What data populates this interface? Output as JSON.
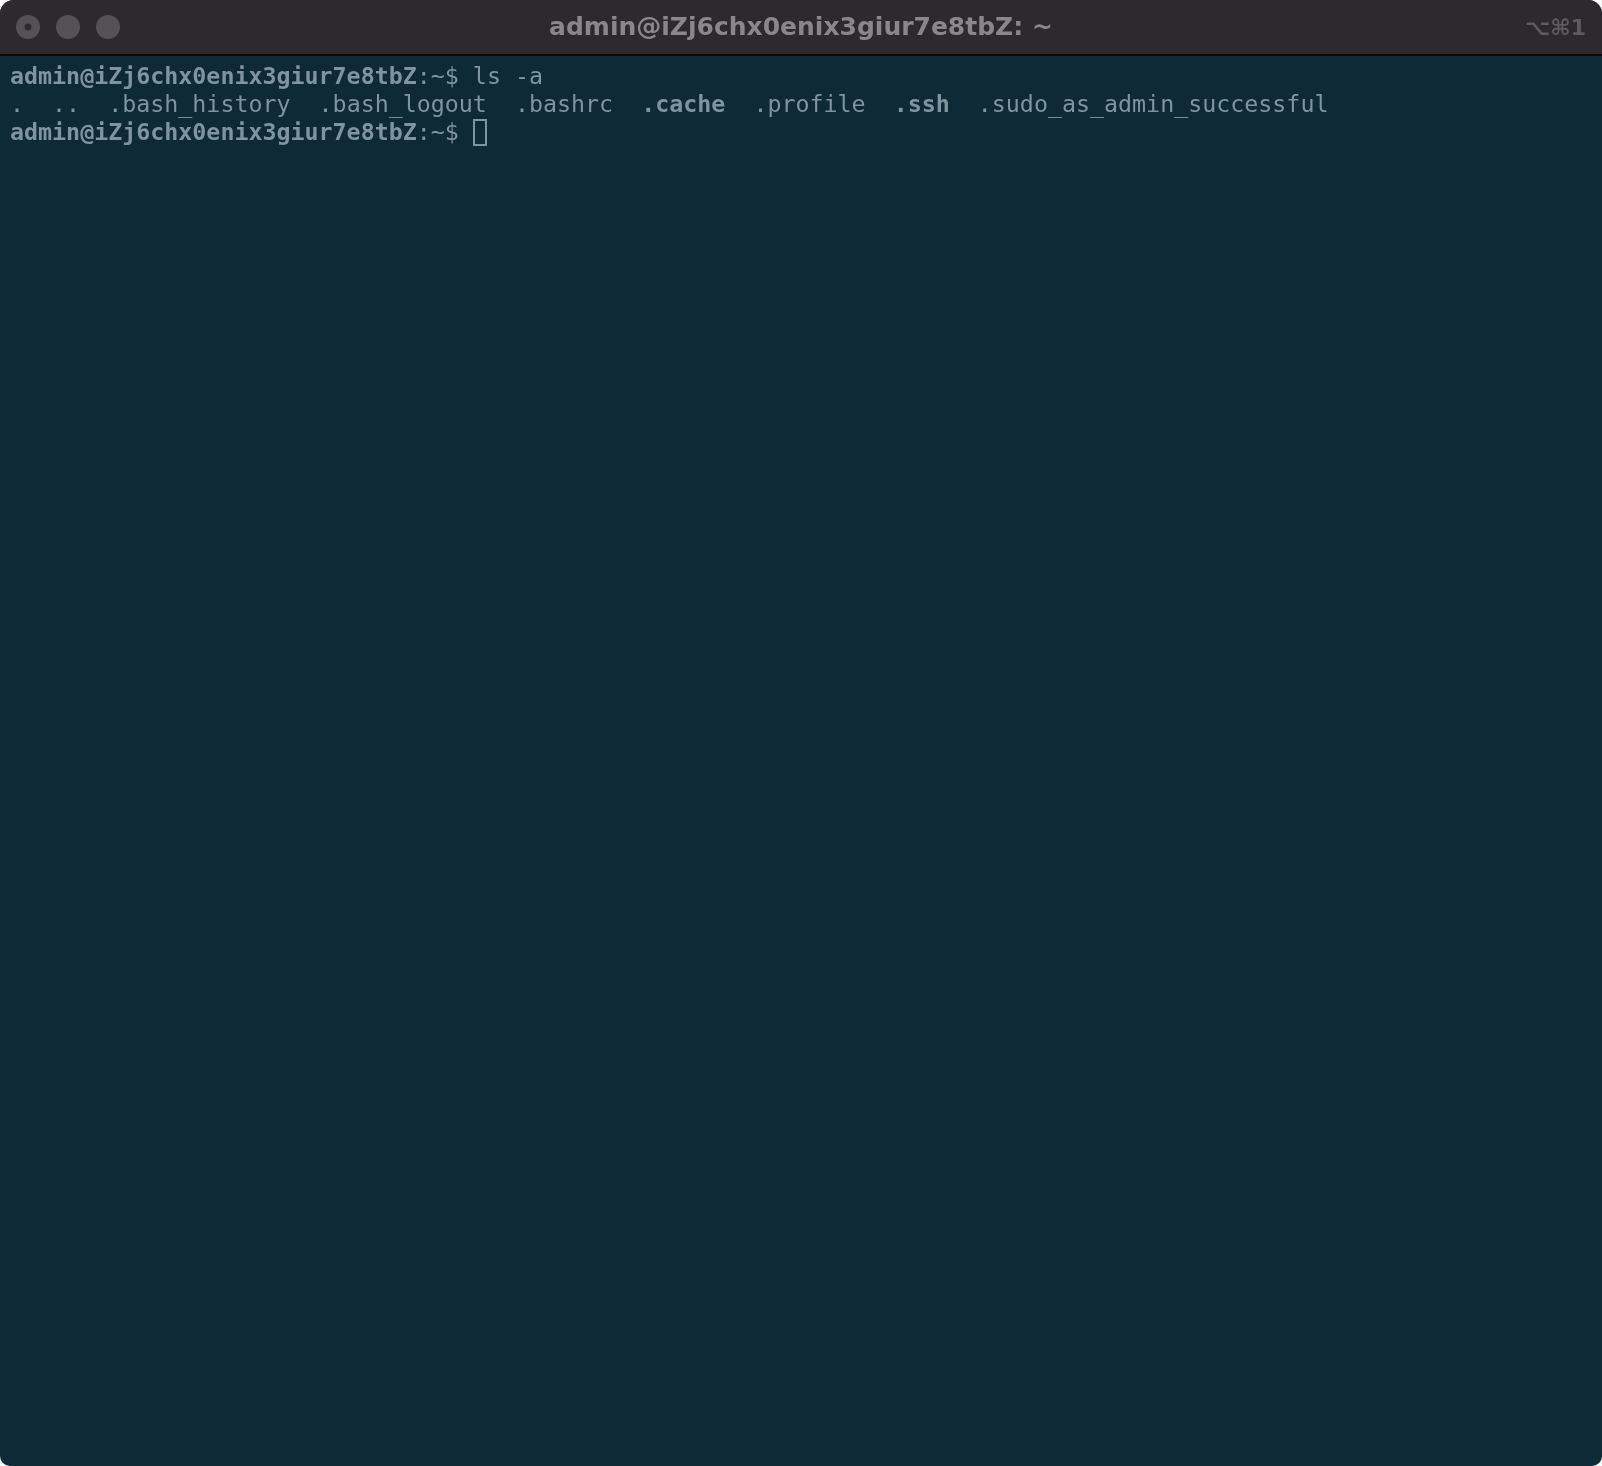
{
  "window": {
    "title": "admin@iZj6chx0enix3giur7e8tbZ: ~",
    "shortcut": "⌥⌘1"
  },
  "lines": [
    {
      "kind": "command",
      "prompt_user": "admin@iZj6chx0enix3giur7e8tbZ",
      "prompt_path": ":~$",
      "command": "ls -a",
      "cursor": false
    },
    {
      "kind": "listing",
      "entries": [
        {
          "name": ".",
          "bold": false
        },
        {
          "name": "..",
          "bold": false
        },
        {
          "name": ".bash_history",
          "bold": false
        },
        {
          "name": ".bash_logout",
          "bold": false
        },
        {
          "name": ".bashrc",
          "bold": false
        },
        {
          "name": ".cache",
          "bold": true
        },
        {
          "name": ".profile",
          "bold": false
        },
        {
          "name": ".ssh",
          "bold": true
        },
        {
          "name": ".sudo_as_admin_successful",
          "bold": false
        }
      ]
    },
    {
      "kind": "command",
      "prompt_user": "admin@iZj6chx0enix3giur7e8tbZ",
      "prompt_path": ":~$",
      "cursor": true
    }
  ]
}
